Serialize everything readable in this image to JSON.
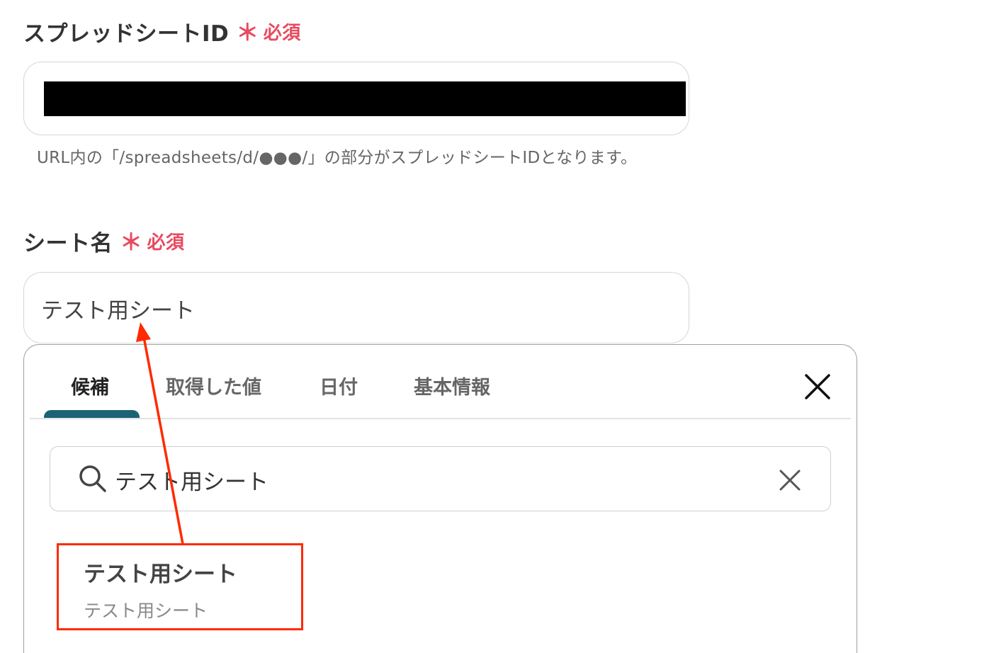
{
  "spreadsheet_field": {
    "label": "スプレッドシートID",
    "required_mark": "＊",
    "required_text": "必須",
    "value_state": "redacted",
    "help_text": "URL内の「/spreadsheets/d/●●●/」の部分がスプレッドシートIDとなります。"
  },
  "sheet_field": {
    "label": "シート名",
    "required_mark": "＊",
    "required_text": "必須",
    "value": "テスト用シート"
  },
  "picker": {
    "tabs": [
      {
        "label": "候補",
        "active": true
      },
      {
        "label": "取得した値",
        "active": false
      },
      {
        "label": "日付",
        "active": false
      },
      {
        "label": "基本情報",
        "active": false
      }
    ],
    "close_icon": "close-icon",
    "search": {
      "icon": "search-icon",
      "value": "テスト用シート",
      "clear_icon": "clear-icon"
    },
    "options": [
      {
        "title": "テスト用シート",
        "subtitle": "テスト用シート"
      }
    ]
  },
  "annotation": {
    "color": "#ff2a00"
  },
  "colors": {
    "required": "#e84a5f",
    "tab_accent": "#1b6375"
  }
}
